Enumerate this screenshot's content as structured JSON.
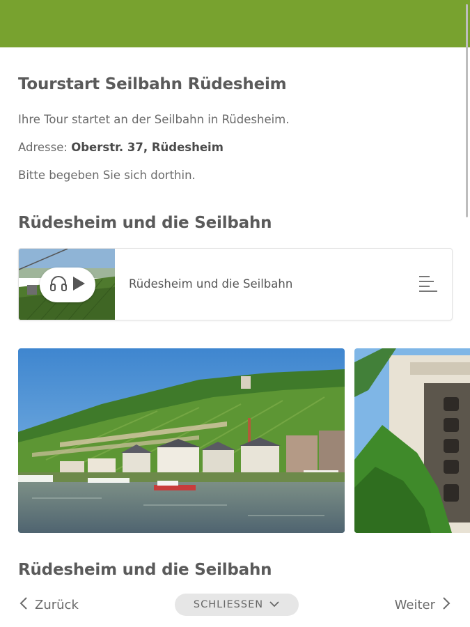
{
  "header": {
    "color": "#78a22f"
  },
  "intro": {
    "title": "Tourstart Seilbahn Rüdesheim",
    "line1": "Ihre Tour startet an der Seilbahn in Rüdesheim.",
    "address_label": "Adresse:",
    "address_value": "Oberstr. 37, Rüdesheim",
    "line3": "Bitte begeben Sie sich dorthin."
  },
  "section1": {
    "title": "Rüdesheim und die Seilbahn",
    "audio": {
      "title": "Rüdesheim und die Seilbahn",
      "icons": [
        "headphones-icon",
        "play-icon",
        "list-icon"
      ]
    }
  },
  "gallery": {
    "photos": [
      "rüdesheim-vineyard-riverside-photo",
      "bell-tower-photo"
    ]
  },
  "section2": {
    "title": "Rüdesheim und die Seilbahn"
  },
  "footer": {
    "back_label": "Zurück",
    "close_label": "SCHLIESSEN",
    "next_label": "Weiter"
  }
}
